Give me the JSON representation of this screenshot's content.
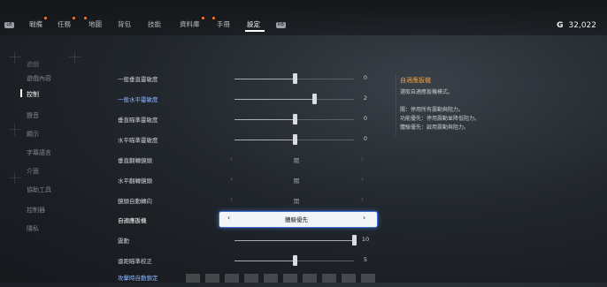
{
  "nav": {
    "bumper_left": "LB",
    "bumper_right": "RB",
    "tabs": [
      {
        "label": "戰備",
        "dot": true,
        "active": false
      },
      {
        "label": "任務",
        "dot": true,
        "active": false
      },
      {
        "label": "地圖",
        "dot": true,
        "active": false
      },
      {
        "label": "背包",
        "dot": false,
        "active": false
      },
      {
        "label": "技能",
        "dot": false,
        "active": false
      },
      {
        "label": "資料庫",
        "dot": true,
        "active": false
      },
      {
        "label": "手冊",
        "dot": true,
        "active": false
      },
      {
        "label": "設定",
        "dot": false,
        "active": true
      }
    ],
    "currency_symbol": "G",
    "currency_value": "32,022"
  },
  "sidebar": {
    "items": [
      {
        "label": "遊戲",
        "active": false
      },
      {
        "label": "遊戲內容",
        "active": false
      },
      {
        "label": "控制",
        "active": true
      },
      {
        "label": "聲音",
        "active": false
      },
      {
        "label": "顯示",
        "active": false
      },
      {
        "label": "字幕語言",
        "active": false
      },
      {
        "label": "介面",
        "active": false
      },
      {
        "label": "協助工具",
        "active": false
      },
      {
        "label": "控制器",
        "active": false
      },
      {
        "label": "隱私",
        "active": false
      }
    ]
  },
  "settings": [
    {
      "label": "一般垂直靈敏度",
      "type": "slider",
      "level": 0.5,
      "value": "0",
      "highlight_label": false
    },
    {
      "label": "一般水平靈敏度",
      "type": "slider",
      "level": 0.67,
      "value": "2",
      "highlight_label": true
    },
    {
      "label": "垂直瞄準靈敏度",
      "type": "slider",
      "level": 0.5,
      "value": "0",
      "highlight_label": false
    },
    {
      "label": "水平瞄準靈敏度",
      "type": "slider",
      "level": 0.5,
      "value": "0",
      "highlight_label": false
    },
    {
      "label": "垂直翻轉鏡頭",
      "type": "select",
      "value": "關",
      "highlight_label": false
    },
    {
      "label": "水平翻轉鏡頭",
      "type": "select",
      "value": "關",
      "highlight_label": false
    },
    {
      "label": "鏡頭自動轉向",
      "type": "select",
      "value": "開",
      "highlight_label": false
    },
    {
      "label": "自適應扳機",
      "type": "select",
      "value": "體驗優先",
      "selected": true,
      "highlight_label": false
    },
    {
      "label": "震動",
      "type": "slider",
      "level": 1.0,
      "value": "10",
      "highlight_label": false
    },
    {
      "label": "遠距瞄準校正",
      "type": "slider",
      "level": 0.5,
      "value": "5",
      "highlight_label": false
    },
    {
      "label": "攻擊時自動鎖定",
      "type": "none",
      "value": "",
      "highlight_label": true
    }
  ],
  "info": {
    "title": "自適應扳機",
    "lines": [
      "選取自適應扳機模式。",
      "",
      "關：停用所有震動與阻力。",
      "功能優先：停用震動並降低阻力。",
      "體驗優先：啟用震動與阻力。"
    ]
  },
  "colors": {
    "accent_orange": "#f0a23c",
    "tab_dot": "#ff7a2e",
    "label_blue": "#8fb7ff",
    "selection_glow": "#3d6fd8"
  }
}
